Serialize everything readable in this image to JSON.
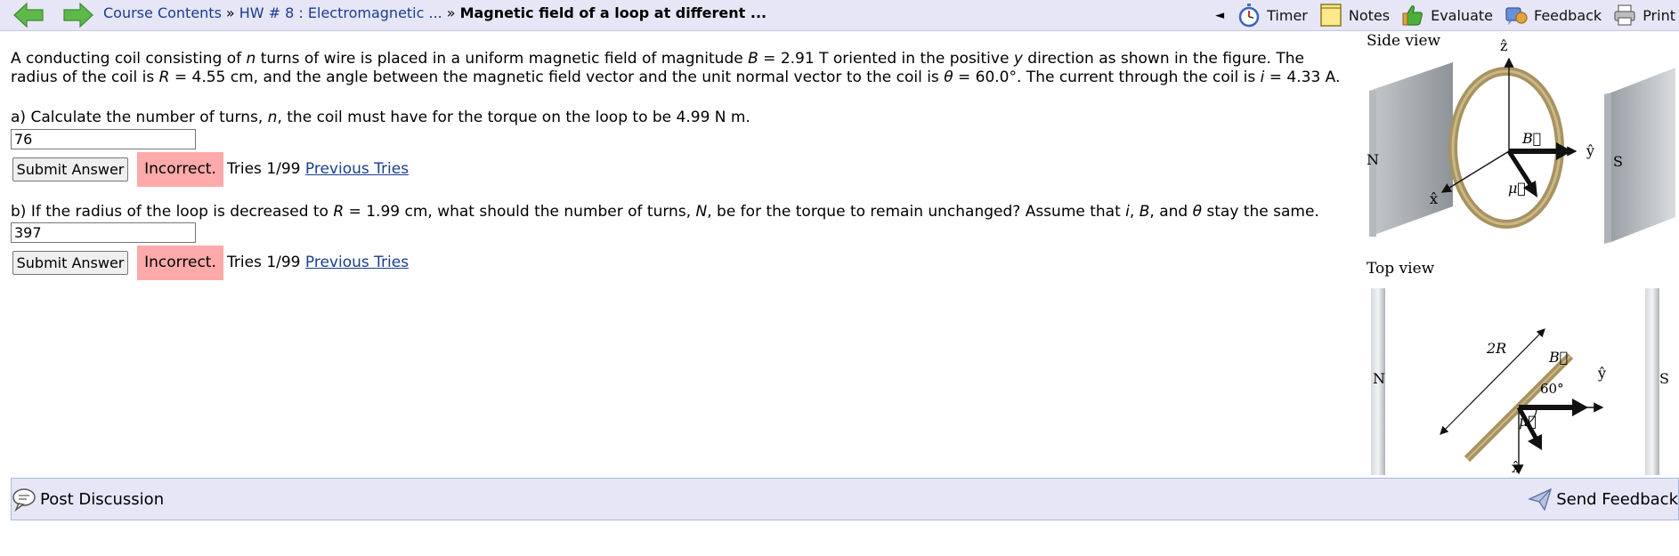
{
  "topbar": {
    "breadcrumb": {
      "course_contents": "Course Contents",
      "separator": "»",
      "homework": "HW # 8 : Electromagnetic ...",
      "current": "Magnetic field of a loop at different ..."
    },
    "collapse_arrow": "◄",
    "tools": {
      "timer": "Timer",
      "notes": "Notes",
      "evaluate": "Evaluate",
      "feedback": "Feedback",
      "print": "Print"
    }
  },
  "problem": {
    "intro_parts": {
      "t1": "A conducting coil consisting of ",
      "n": "n",
      "t2": " turns of wire is placed in a uniform magnetic field of magnitude ",
      "B": "B",
      "t3": " = 2.91 T oriented in the positive ",
      "y": "y",
      "t4": " direction as shown in the figure. The radius of the coil is ",
      "R": "R",
      "t5": " = 4.55 cm, and the angle between the magnetic field vector and the unit normal vector to the coil is ",
      "theta": "θ",
      "t6": " = 60.0°. The current through the coil is ",
      "i": "i",
      "t7": " = 4.33 A."
    },
    "part_a": {
      "q1": "a) Calculate the number of turns, ",
      "n": "n",
      "q2": ", the coil must have for the torque on the loop to be 4.99 N m.",
      "answer": "76",
      "submit": "Submit Answer",
      "status": "Incorrect.",
      "tries": "Tries 1/99",
      "previous": "Previous Tries"
    },
    "part_b": {
      "q1": "b) If the radius of the loop is decreased to ",
      "R": "R",
      "q2": " = 1.99 cm, what should the number of turns, ",
      "N": "N",
      "q3": ", be for the torque to remain unchanged? Assume that ",
      "i": "i",
      "q4": ", ",
      "B": "B",
      "q5": ", and ",
      "theta": "θ",
      "q6": " stay the same.",
      "answer": "397",
      "submit": "Submit Answer",
      "status": "Incorrect.",
      "tries": "Tries 1/99",
      "previous": "Previous Tries"
    }
  },
  "figure": {
    "side_view": {
      "title": "Side view",
      "z": "ẑ",
      "y": "ŷ",
      "x": "x̂",
      "B": "B⃗",
      "mu": "μ⃗",
      "N": "N",
      "S": "S"
    },
    "top_view": {
      "title": "Top view",
      "two_r": "2R",
      "angle": "60°",
      "y": "ŷ",
      "x": "x̂",
      "B": "B⃗",
      "mu": "μ⃗",
      "N": "N",
      "S": "S"
    }
  },
  "bottombar": {
    "post_discussion": "Post Discussion",
    "send_feedback": "Send Feedback"
  },
  "colors": {
    "bar_bg": "#e6e6f6",
    "incorrect_bg": "#ffaaaa",
    "link": "#1a3d8f",
    "nav_arrow": "#5fb84a",
    "coil": "#a8925f"
  }
}
